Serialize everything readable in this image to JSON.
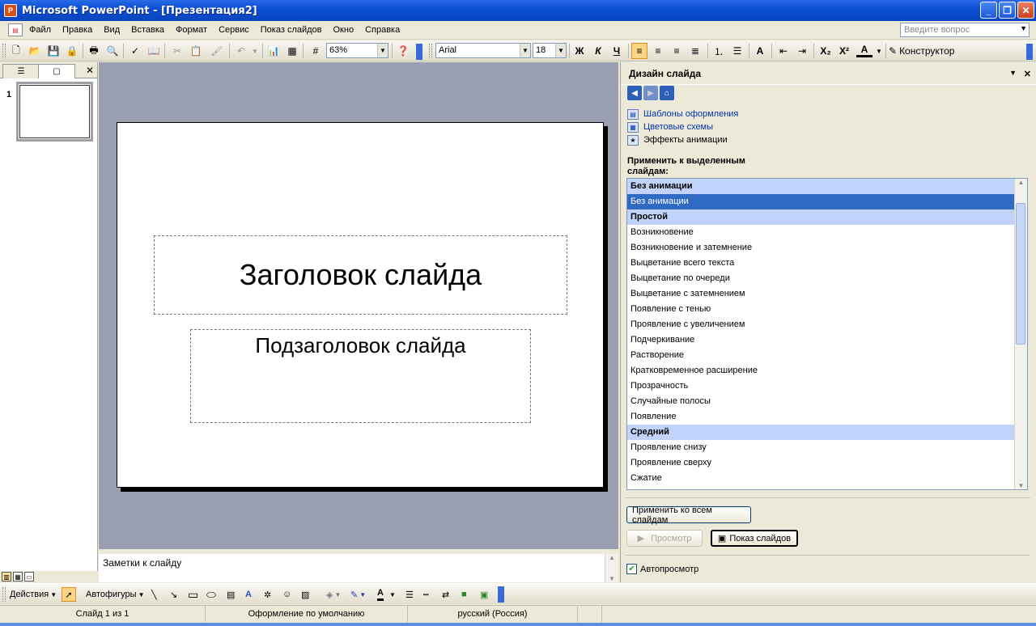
{
  "window": {
    "title": "Microsoft PowerPoint - [Презентация2]"
  },
  "menu": {
    "items": [
      "Файл",
      "Правка",
      "Вид",
      "Вставка",
      "Формат",
      "Сервис",
      "Показ слайдов",
      "Окно",
      "Справка"
    ],
    "help_placeholder": "Введите вопрос"
  },
  "toolbar": {
    "zoom": "63%",
    "font_name": "Arial",
    "font_size": "18",
    "bold_label": "Ж",
    "italic_label": "К",
    "underline_label": "Ч",
    "designer_label": "Конструктор"
  },
  "slides_pane": {
    "slide_number": "1"
  },
  "slide": {
    "title_placeholder": "Заголовок слайда",
    "subtitle_placeholder": "Подзаголовок слайда"
  },
  "notes": {
    "placeholder": "Заметки к слайду"
  },
  "task_pane": {
    "title": "Дизайн слайда",
    "links": [
      "Шаблоны оформления",
      "Цветовые схемы",
      "Эффекты анимации"
    ],
    "apply_label": "Применить к выделенным слайдам:",
    "list": [
      {
        "text": "Без анимации",
        "type": "group"
      },
      {
        "text": "Без анимации",
        "type": "selected"
      },
      {
        "text": "Простой",
        "type": "group"
      },
      {
        "text": "Возникновение",
        "type": "item"
      },
      {
        "text": "Возникновение и затемнение",
        "type": "item"
      },
      {
        "text": "Выцветание всего текста",
        "type": "item"
      },
      {
        "text": "Выцветание по очереди",
        "type": "item"
      },
      {
        "text": "Выцветание с затемнением",
        "type": "item"
      },
      {
        "text": "Появление с тенью",
        "type": "item"
      },
      {
        "text": "Проявление с увеличением",
        "type": "item"
      },
      {
        "text": "Подчеркивание",
        "type": "item"
      },
      {
        "text": "Растворение",
        "type": "item"
      },
      {
        "text": "Кратковременное расширение",
        "type": "item"
      },
      {
        "text": "Прозрачность",
        "type": "item"
      },
      {
        "text": "Случайные полосы",
        "type": "item"
      },
      {
        "text": "Появление",
        "type": "item"
      },
      {
        "text": "Средний",
        "type": "group"
      },
      {
        "text": "Проявление снизу",
        "type": "item"
      },
      {
        "text": "Проявление сверху",
        "type": "item"
      },
      {
        "text": "Сжатие",
        "type": "item"
      }
    ],
    "apply_all_button": "Применить ко всем слайдам",
    "preview_button": "Просмотр",
    "slideshow_button": "Показ слайдов",
    "autopreview_label": "Автопросмотр",
    "autopreview_checked": true
  },
  "drawing_toolbar": {
    "actions_label": "Действия",
    "autoshapes_label": "Автофигуры"
  },
  "status": {
    "slide_info": "Слайд 1 из 1",
    "design": "Оформление по умолчанию",
    "language": "русский (Россия)"
  }
}
